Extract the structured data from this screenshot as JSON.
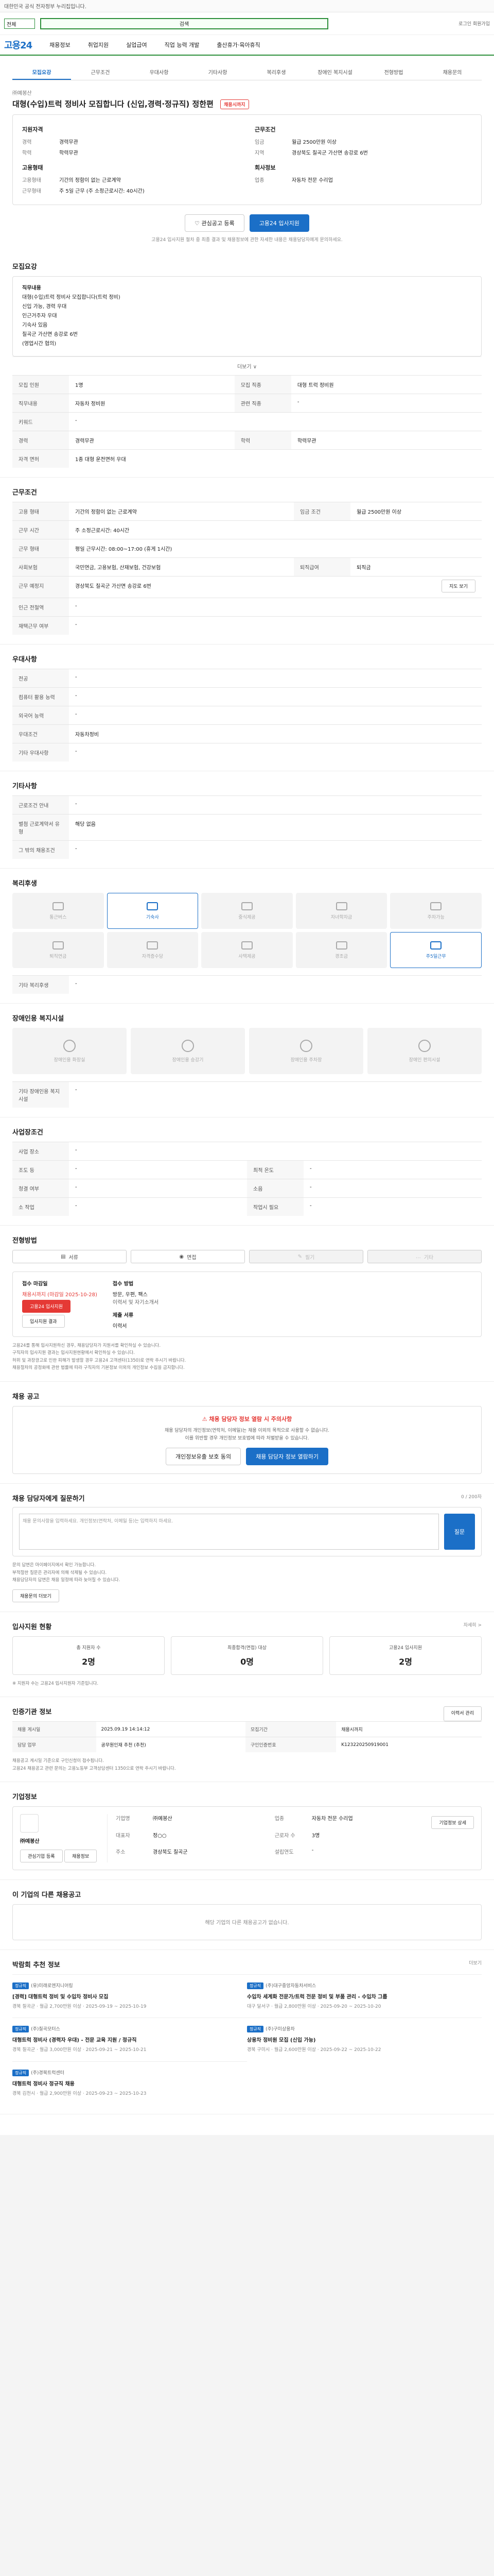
{
  "top": {
    "notice": "대한민국 공식 전자정부 누리집입니다."
  },
  "search": {
    "category": "전체",
    "placeholder": "검색",
    "right_links": "로그인   회원가입"
  },
  "gnb": {
    "logo": "고용24",
    "items": [
      "채용정보",
      "취업지원",
      "실업급여",
      "직업 능력 개발",
      "출산휴가·육아휴직"
    ]
  },
  "tabs": [
    "모집요강",
    "근무조건",
    "우대사항",
    "기타사항",
    "복리후생",
    "장애인 복지시설",
    "전형방법",
    "채용문의"
  ],
  "job": {
    "company": "㈜예봉산",
    "title": "대형(수입)트럭 정비사 모집합니다 (신입,경력·정규직) 정한편",
    "badge": "채용시까지",
    "summary_left_title": "지원자격",
    "summary_left": [
      [
        "경력",
        "경력무관"
      ],
      [
        "학력",
        "학력무관"
      ]
    ],
    "summary_left2_title": "고용형태",
    "summary_left2": [
      [
        "고용형태",
        "기간의 정함이 없는 근로계약"
      ],
      [
        "근무형태",
        "주 5일 근무 (주 소정근로시간: 40시간)"
      ]
    ],
    "summary_right_title": "근무조건",
    "summary_right": [
      [
        "임금",
        "월급 2500만원 이상"
      ],
      [
        "지역",
        "경상북도 칠곡군 가산면 송강로 6번"
      ]
    ],
    "summary_right2_title": "회사정보",
    "summary_right2": [
      [
        "업종",
        "자동차 전문 수리업"
      ]
    ],
    "btn_scrap": "관심공고 등록",
    "btn_apply": "고용24 입사지원",
    "notice_text": "고용24 입사지원 절차 중 최종 결과 및 채용정보에 관한 자세한 내용은 채용담당자에게 문의하세요."
  },
  "recruit": {
    "title": "모집요강",
    "content_lines": [
      "직무내용",
      "대형(수입)트럭 정비사 모집합니다(트럭 정비)",
      "신입 가능, 경력 우대",
      "인근거주자 우대",
      "기숙사 있음",
      "칠곡군 가산면 송강로 6번",
      "(영업시간 협의)"
    ],
    "more": "더보기 ∨",
    "rows": [
      [
        "모집 인원",
        "1명",
        "모집 직종",
        "대형 트럭 정비원"
      ],
      [
        "직무내용",
        "자동차 정비원",
        "관련 직종",
        "-"
      ],
      [
        "키워드",
        "-",
        "",
        ""
      ],
      [
        "경력",
        "경력무관",
        "학력",
        "학력무관"
      ],
      [
        "자격 면허",
        "1종 대형 운전면허 우대",
        "",
        ""
      ]
    ]
  },
  "conditions": {
    "title": "근무조건",
    "rows": [
      [
        "고용 형태",
        "기간의 정함이 없는 근로계약",
        "임금 조건",
        "월급 2500만원 이상"
      ],
      [
        "근무 시간",
        "주 소정근로시간: 40시간",
        "",
        ""
      ],
      [
        "근무 형태",
        "평일 근무시간: 08:00~17:00 (휴게 1시간)",
        "",
        ""
      ],
      [
        "사회보험",
        "국민연금, 고용보험, 산재보험, 건강보험",
        "퇴직급여",
        "퇴직금"
      ],
      [
        "근무 예정지",
        "경상북도 칠곡군 가산면 송강로 6번",
        "",
        ""
      ],
      [
        "인근 전철역",
        "-",
        "",
        ""
      ],
      [
        "재택근무 여부",
        "-",
        "",
        ""
      ]
    ],
    "map_btn": "지도 보기"
  },
  "preference": {
    "title": "우대사항",
    "rows": [
      [
        "전공",
        "-"
      ],
      [
        "컴퓨터 활용 능력",
        "-"
      ],
      [
        "외국어 능력",
        "-"
      ],
      [
        "우대조건",
        "자동차정비"
      ],
      [
        "기타 우대사항",
        "-"
      ]
    ]
  },
  "etc": {
    "title": "기타사항",
    "rows": [
      [
        "근로조건 안내",
        "-"
      ],
      [
        "별첨 근로계약서 유형",
        "해당 없음"
      ],
      [
        "그 밖의 채용조건",
        "-"
      ]
    ]
  },
  "welfare": {
    "title": "복리후생",
    "items": [
      "통근버스",
      "기숙사",
      "중식제공",
      "자녀학자금",
      "주차가능",
      "퇴직연금",
      "자격증수당",
      "사택제공",
      "경조금",
      "주5일근무"
    ],
    "active": [
      1,
      9
    ],
    "etc_label": "기타 복리후생",
    "etc_value": "-"
  },
  "disability": {
    "title": "장애인용 복지시설",
    "items": [
      "장애인용 화장실",
      "장애인용 승강기",
      "장애인용 주차장",
      "장애인 편의시설"
    ],
    "etc_label": "기타 장애인용 복지시설",
    "etc_value": "-"
  },
  "workplace": {
    "title": "사업장조건",
    "rows": [
      [
        "사업 장소",
        "-",
        "",
        ""
      ],
      [
        "조도 등",
        "-",
        "최적 온도",
        "-"
      ],
      [
        "청결 여부",
        "-",
        "소음",
        "-"
      ],
      [
        "소 작업",
        "-",
        "작업시 필요",
        "-"
      ]
    ]
  },
  "selection": {
    "title": "전형방법",
    "methods": [
      "서류",
      "면접",
      "필기",
      "기타"
    ],
    "methods_off": [
      2,
      3
    ],
    "apply_method_title": "접수 마감일",
    "apply_method_value": "채용시까지 (마감일 2025-10-28)",
    "apply_btn": "고용24 입사지원",
    "email_btn": "입사지원 결과",
    "docs_title": "접수 방법",
    "docs_value": "방문, 우편, 팩스",
    "docs2": "이력서 및 자기소개서",
    "fax_title": "제출 서류",
    "fax_value": "이력서",
    "bullets": [
      "고용24를 통해 입사지원하신 경우, 채용담당자가 지원서를 확인하실 수 있습니다.",
      "구직자의 입사지원 결과는 입사지원현황에서 확인하실 수 있습니다.",
      "허위 및 과장광고로 인한 피해가 발생할 경우 고용24 고객센터(1350)로 연락 주시기 바랍니다.",
      "채용절차의 공정화에 관한 법률에 따라 구직자의 기본정보 이외의 개인정보 수집을 금지합니다."
    ]
  },
  "report": {
    "title": "채용 공고",
    "warn": "⚠ 채용 담당자 정보 열람 시 주의사항",
    "desc": "채용 담당자의 개인정보(연락처, 이메일)는 채용 이외의 목적으로 사용할 수 없습니다.\n이를 위반할 경우 개인정보 보호법에 따라 처벌받을 수 있습니다.",
    "btn_left": "개인정보유출 보호 동의",
    "btn_right": "채용 담당자 정보 열람하기"
  },
  "inquiry": {
    "title": "채용 담당자에게 질문하기",
    "counter": "0 / 200자",
    "placeholder": "채용 문의사항을 입력하세요. 개인정보(연락처, 이메일 등)는 입력하지 마세요.",
    "submit": "질문",
    "bullets": [
      "문의 답변은 마이페이지에서 확인 가능합니다.",
      "부적절한 질문은 관리자에 의해 삭제될 수 있습니다.",
      "채용담당자의 답변은 채용 일정에 따라 늦어질 수 있습니다."
    ],
    "more_btn": "채용문의 더보기"
  },
  "stats": {
    "title": "입사지원 현황",
    "link": "자세히 >",
    "items": [
      [
        "총 지원자 수",
        "2명"
      ],
      [
        "최종합격(면접) 대상",
        "0명"
      ],
      [
        "고용24 입사지원",
        "2명"
      ]
    ],
    "note": "※ 지원자 수는 고용24 입사지원자 기준입니다."
  },
  "period": {
    "title": "인증기관 정보",
    "btn": "이력서 관리",
    "rows": [
      [
        "채용 게시일",
        "2025.09.19 14:14:12",
        "모집기간",
        "채용시까지"
      ],
      [
        "담당 업무",
        "공무원인재 추천 (추천)",
        "구인인증번호",
        "K123220250919001"
      ]
    ],
    "bullets": [
      "채용공고 게시일 기준으로 구인신청이 접수됩니다.",
      "고용24 채용공고 관련 문의는 고용노동부 고객상담센터 1350으로 연락 주시기 바랍니다."
    ]
  },
  "company": {
    "title": "기업정보",
    "name": "㈜예봉산",
    "btn1": "관심기업 등록",
    "btn2": "채용정보",
    "info": [
      [
        "기업명",
        "㈜예봉산"
      ],
      [
        "업종",
        "자동차 전문 수리업"
      ],
      [
        "대표자",
        "정○○"
      ],
      [
        "근로자 수",
        "3명"
      ],
      [
        "주소",
        "경상북도 칠곡군"
      ],
      [
        "설립연도",
        "-"
      ]
    ],
    "more_btn": "기업정보 상세"
  },
  "others": {
    "title": "이 기업의 다른 채용공고",
    "empty": "해당 기업의 다른 채용공고가 없습니다."
  },
  "recommend": {
    "title": "박람회 추천 정보",
    "more": "더보기",
    "cards": [
      {
        "tag": "정규직",
        "company": "(유)미래로엔지니어링",
        "title": "[경력] 대형트럭 정비 및 수입차 정비사 모집",
        "meta": "경북 칠곡군 · 월급 2,700만원 이상 · 2025-09-19 ~ 2025-10-19"
      },
      {
        "tag": "정규직",
        "company": "(주)대구중앙자동차서비스",
        "title": "수입차 세계화 전문가/트럭 전문 정비 및 부품 관리 - 수입차 그룹",
        "meta": "대구 달서구 · 월급 2,800만원 이상 · 2025-09-20 ~ 2025-10-20"
      },
      {
        "tag": "정규직",
        "company": "(주)칠곡모터스",
        "title": "대형트럭 정비사 (경력자 우대) - 전문 교육 지원 / 정규직",
        "meta": "경북 칠곡군 · 월급 3,000만원 이상 · 2025-09-21 ~ 2025-10-21"
      },
      {
        "tag": "정규직",
        "company": "(주)구미상용차",
        "title": "상용차 정비원 모집 (신입 가능)",
        "meta": "경북 구미시 · 월급 2,600만원 이상 · 2025-09-22 ~ 2025-10-22"
      },
      {
        "tag": "정규직",
        "company": "(주)경북트럭센터",
        "title": "대형트럭 정비사 정규직 채용",
        "meta": "경북 김천시 · 월급 2,900만원 이상 · 2025-09-23 ~ 2025-10-23"
      }
    ]
  }
}
